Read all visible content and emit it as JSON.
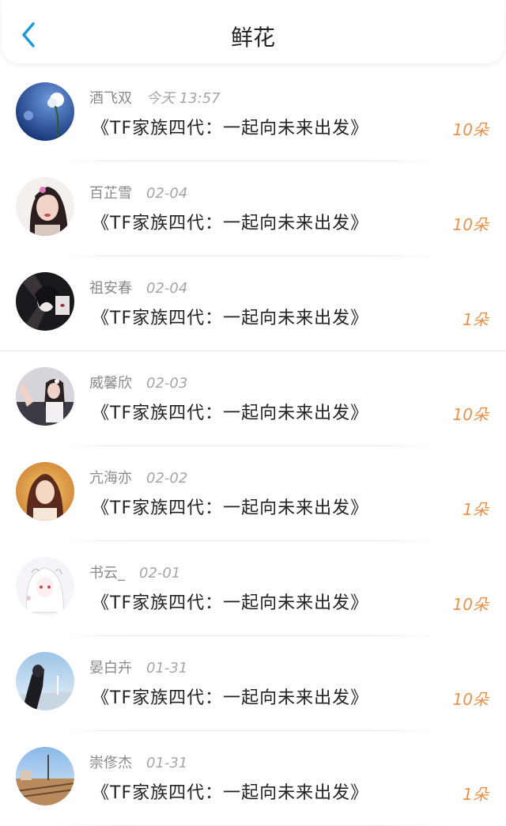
{
  "header": {
    "title": "鲜花",
    "back_icon": "chevron-left-icon",
    "accent_color": "#1e9bd7"
  },
  "colors": {
    "count": "#e8914a",
    "name": "#8a8a8a",
    "text": "#222222"
  },
  "items": [
    {
      "name": "酒飞双",
      "date": "今天 13:57",
      "work": "《TF家族四代：一起向未来出发》",
      "count": "10朵"
    },
    {
      "name": "百芷雪",
      "date": "02-04",
      "work": "《TF家族四代：一起向未来出发》",
      "count": "10朵"
    },
    {
      "name": "祖安春",
      "date": "02-04",
      "work": "《TF家族四代：一起向未来出发》",
      "count": "1朵"
    },
    {
      "name": "威馨欣",
      "date": "02-03",
      "work": "《TF家族四代：一起向未来出发》",
      "count": "10朵"
    },
    {
      "name": "亢海亦",
      "date": "02-02",
      "work": "《TF家族四代：一起向未来出发》",
      "count": "1朵"
    },
    {
      "name": "书云_",
      "date": "02-01",
      "work": "《TF家族四代：一起向未来出发》",
      "count": "10朵"
    },
    {
      "name": "晏白卉",
      "date": "01-31",
      "work": "《TF家族四代：一起向未来出发》",
      "count": "10朵"
    },
    {
      "name": "崇俢杰",
      "date": "01-31",
      "work": "《TF家族四代：一起向未来出发》",
      "count": "1朵"
    }
  ]
}
